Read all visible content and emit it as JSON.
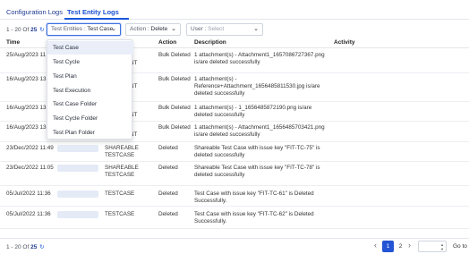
{
  "tabs": [
    {
      "label": "Configuration Logs"
    },
    {
      "label": "Test Entity Logs"
    }
  ],
  "filters": {
    "count_prefix": "1 - 20 Of",
    "count_total": "25",
    "refresh_icon": "↻",
    "entity_label": "Test Entities :",
    "entity_value": "Test Case",
    "action_label": "Action :",
    "action_value": "Delete",
    "user_label": "User :",
    "user_placeholder": "Select",
    "chevron": "⌄"
  },
  "columns": {
    "time": "Time",
    "type_suffix": "e",
    "action": "Action",
    "description": "Description",
    "activity": "Activity"
  },
  "entity_menu": [
    {
      "label": "Test Case",
      "selected": true
    },
    {
      "label": "Test Cycle"
    },
    {
      "label": "Test Plan"
    },
    {
      "label": "Test Execution"
    },
    {
      "label": "Test Case Folder"
    },
    {
      "label": "Test Cycle Folder"
    },
    {
      "label": "Test Plan Folder"
    }
  ],
  "rows": [
    {
      "time": "25/Aug/2023 11",
      "type": "",
      "action": "Bulk Deleted",
      "desc1": "1 attachment(s) - Attachment1_1657086727367.png",
      "desc2": "is/are deleted successfully",
      "desc3": ""
    },
    {
      "time": "",
      "type": "NT",
      "action": "",
      "desc1": "",
      "desc2": "",
      "desc3": ""
    },
    {
      "time": "16/Aug/2023 13",
      "type": "",
      "action": "Bulk Deleted",
      "desc1": "1 attachment(s) -",
      "desc2": "Reference+Attachment_1656485811530.jpg is/are",
      "desc3": "deleted successfully"
    },
    {
      "time": "",
      "type": "NT",
      "action": "",
      "desc1": "",
      "desc2": "",
      "desc3": ""
    },
    {
      "time": "16/Aug/2023 13",
      "type": "",
      "action": "Bulk Deleted",
      "desc1": "1 attachment(s) - 1_1656485872190.png is/are",
      "desc2": "deleted successfully",
      "desc3": ""
    },
    {
      "time": "",
      "type": "NT",
      "action": "",
      "desc1": "",
      "desc2": "",
      "desc3": ""
    },
    {
      "time": "16/Aug/2023 13",
      "type": "",
      "action": "Bulk Deleted",
      "desc1": "1 attachment(s) - Attachment1_1656485703421.png",
      "desc2": "is/are deleted successfully",
      "desc3": ""
    },
    {
      "time": "",
      "type": "NT",
      "action": "",
      "desc1": "",
      "desc2": "",
      "desc3": ""
    },
    {
      "time": "23/Dec/2022 11:49",
      "type": "SHAREABLE",
      "type2": "TESTCASE",
      "action": "Deleted",
      "desc1": "Shareable Test Case with issue key \"FIT-TC-75\" is",
      "desc2": "deleted successfully",
      "desc3": ""
    },
    {
      "time": "23/Dec/2022 11:05",
      "type": "SHAREABLE",
      "type2": "TESTCASE",
      "action": "Deleted",
      "desc1": "Shareable Test Case with issue key \"FIT-TC-78\" is",
      "desc2": "deleted successfully",
      "desc3": ""
    },
    {
      "time": "05/Jul/2022 11:36",
      "type": "TESTCASE",
      "type2": "",
      "action": "Deleted",
      "desc1": "Test Case with issue key \"FIT-TC-61\" is Deleted",
      "desc2": "Successfully.",
      "desc3": ""
    },
    {
      "time": "05/Jul/2022 11:36",
      "type": "TESTCASE",
      "type2": "",
      "action": "Deleted",
      "desc1": "Test Case with issue key \"FIT-TC-62\" is Deleted",
      "desc2": "Successfully.",
      "desc3": ""
    }
  ],
  "footer": {
    "count_prefix": "1 - 20 Of",
    "count_total": "25",
    "refresh_icon": "↻",
    "prev": "‹",
    "next": "›",
    "pages": [
      "1",
      "2"
    ],
    "goto_label": "Go to"
  }
}
